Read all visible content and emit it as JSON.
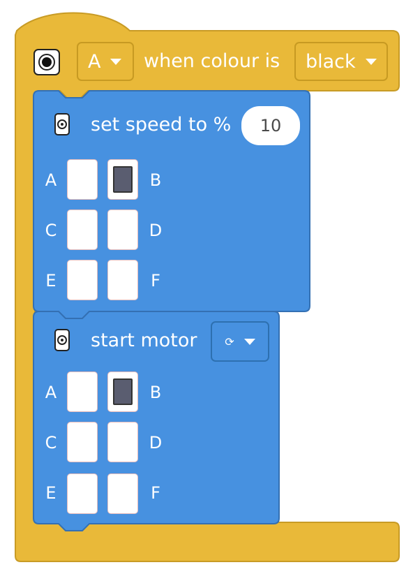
{
  "hat_block": {
    "icon": "color-sensor-icon",
    "port": {
      "value": "A"
    },
    "label": "when colour is",
    "colour": {
      "value": "black"
    },
    "accent": "#e9b939"
  },
  "set_speed_block": {
    "icon": "motor-hub-icon",
    "label": "set speed to %",
    "value": "10",
    "ports": [
      {
        "name": "A",
        "selected": false
      },
      {
        "name": "B",
        "selected": true
      },
      {
        "name": "C",
        "selected": false
      },
      {
        "name": "D",
        "selected": false
      },
      {
        "name": "E",
        "selected": false
      },
      {
        "name": "F",
        "selected": false
      }
    ],
    "accent": "#4791e0"
  },
  "start_motor_block": {
    "icon": "motor-hub-icon",
    "label": "start motor",
    "direction": {
      "value": "⟳",
      "icon": "clockwise-arrow-icon"
    },
    "ports": [
      {
        "name": "A",
        "selected": false
      },
      {
        "name": "B",
        "selected": true
      },
      {
        "name": "C",
        "selected": false
      },
      {
        "name": "D",
        "selected": false
      },
      {
        "name": "E",
        "selected": false
      },
      {
        "name": "F",
        "selected": false
      }
    ],
    "accent": "#4791e0"
  }
}
